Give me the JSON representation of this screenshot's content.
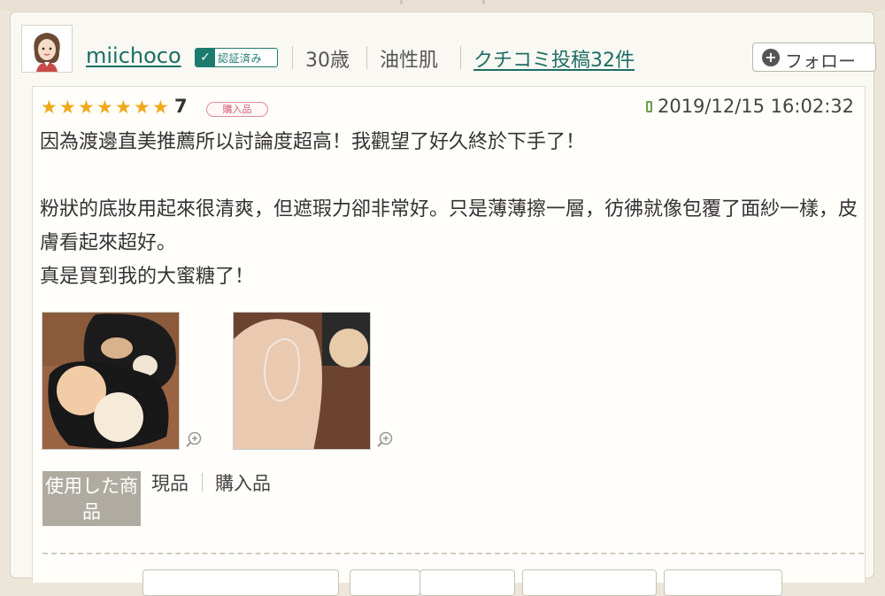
{
  "user": {
    "name": "miichoco",
    "verified_label": "認証済み",
    "age": "30歳",
    "skin_type": "油性肌",
    "posts_link": "クチコミ投稿32件",
    "follow_label": "フォロー"
  },
  "review": {
    "rating": "7",
    "star_count": 7,
    "purchase_badge": "購入品",
    "date": "2019/12/15 16:02:32",
    "paragraphs": [
      "因為渡邊直美推薦所以討論度超高！我觀望了好久終於下手了！",
      "粉狀的底妝用起來很清爽，但遮瑕力卻非常好。只是薄薄擦一層，彷彿就像包覆了面紗一樣，皮膚看起來超好。",
      "真是買到我的大蜜糖了！"
    ],
    "used_product_label": "使用した商品",
    "used_tags": [
      "現品",
      "購入品"
    ]
  },
  "colors": {
    "link": "#1c6e66",
    "star": "#f2a81a",
    "badge": "#d35f77",
    "label_bg": "#b0aba1"
  },
  "icons": [
    "user-avatar",
    "check-icon",
    "plus-circle-icon",
    "star-icon",
    "mobile-phone-icon",
    "zoom-in-icon"
  ]
}
